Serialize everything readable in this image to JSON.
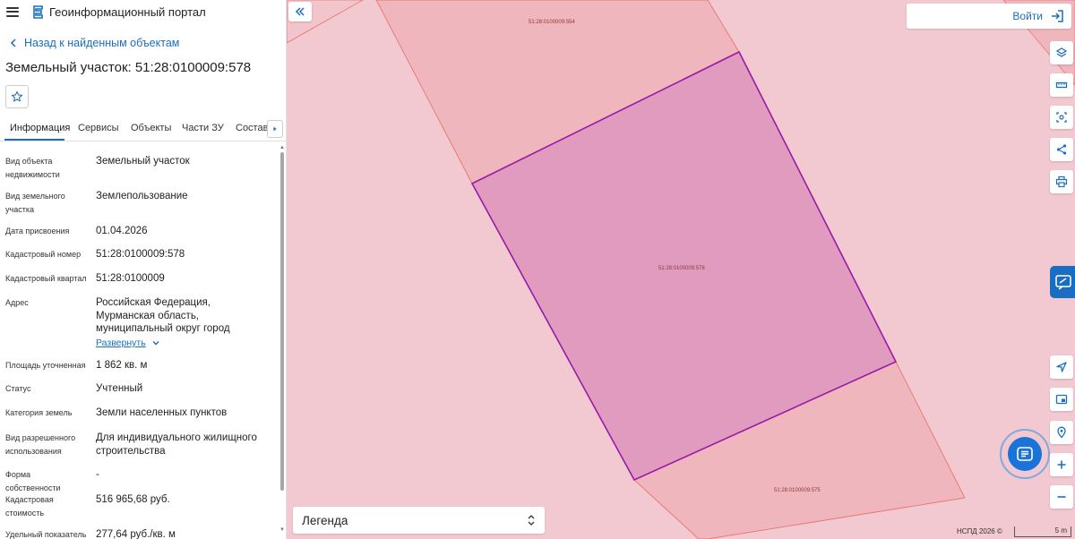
{
  "header": {
    "app_title": "Геоинформационный портал"
  },
  "nav": {
    "back_label": "Назад к найденным объектам"
  },
  "object": {
    "title": "Земельный участок: 51:28:0100009:578"
  },
  "tabs": [
    {
      "label": "Информация"
    },
    {
      "label": "Сервисы"
    },
    {
      "label": "Объекты"
    },
    {
      "label": "Части ЗУ"
    },
    {
      "label": "Состав"
    }
  ],
  "properties": [
    {
      "label": "Вид объекта недвижимости",
      "value": "Земельный участок"
    },
    {
      "label": "Вид земельного участка",
      "value": "Землепользование"
    },
    {
      "label": "Дата присвоения",
      "value": "01.04.2026"
    },
    {
      "label": "Кадастровый номер",
      "value": "51:28:0100009:578"
    },
    {
      "label": "Кадастровый квартал",
      "value": "51:28:0100009"
    },
    {
      "label": "Адрес",
      "value": "Российская Федерация, Мурманская область, муниципальный округ город Полярные Зори, населенный"
    },
    {
      "label": "Площадь уточненная",
      "value": "1 862 кв. м"
    },
    {
      "label": "Статус",
      "value": "Учтенный"
    },
    {
      "label": "Категория земель",
      "value": "Земли населенных пунктов"
    },
    {
      "label": "Вид разрешенного использования",
      "value": "Для индивидуального жилищного строительства"
    },
    {
      "label": "Форма собственности",
      "value": "-"
    },
    {
      "label": "Кадастровая стоимость",
      "value": "516 965,68 руб."
    },
    {
      "label": "Удельный показатель",
      "value": "277,64 руб./кв. м"
    }
  ],
  "expand_label": "Развернуть",
  "map": {
    "login_label": "Войти",
    "legend_label": "Легенда",
    "attribution": "НСПД 2026 ©",
    "scale_label": "5 m",
    "parcel_labels": {
      "top": "51:28:0100009:554",
      "center": "51:28:0100009:578",
      "bottom": "51:28:0100009:575"
    }
  },
  "colors": {
    "accent": "#1a6ec2",
    "map_background": "#f2c9d0",
    "parcel_fill": "#f0b6bd",
    "selected_fill": "#e19bbf",
    "selected_stroke": "#9a1aa8",
    "parcel_stroke": "#e8766f"
  },
  "icons": {
    "menu": "hamburger-icon",
    "logo": "portal-logo-icon",
    "favorite": "star-icon",
    "layers": "layers-icon",
    "measure": "ruler-icon",
    "select": "area-select-icon",
    "share": "share-icon",
    "print": "print-icon",
    "locate": "locate-icon",
    "minimap": "minimap-icon",
    "geo": "geo-pin-icon",
    "zoom_in": "plus-icon",
    "zoom_out": "minus-icon",
    "chat": "chat-icon"
  }
}
